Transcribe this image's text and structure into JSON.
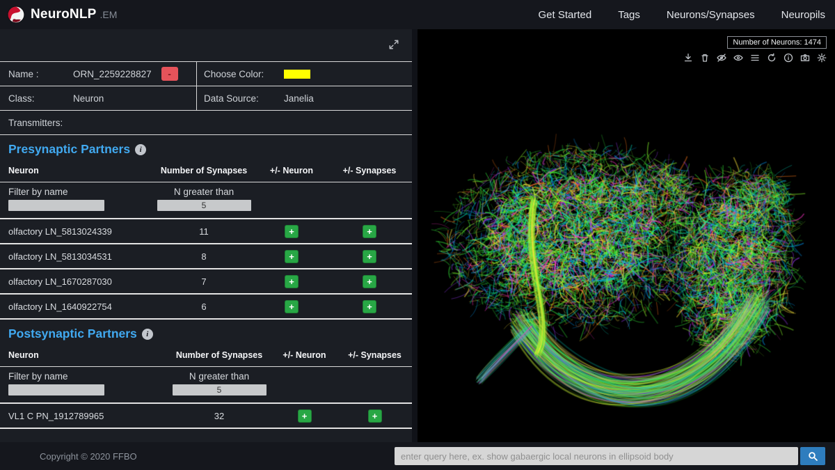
{
  "navbar": {
    "brand": "NeuroNLP",
    "brand_suffix": ".EM",
    "items": [
      {
        "label": "Get Started"
      },
      {
        "label": "Tags"
      },
      {
        "label": "Neurons/Synapses"
      },
      {
        "label": "Neuropils"
      }
    ]
  },
  "info_panel": {
    "name_label": "Name :",
    "name_value": "ORN_2259228827",
    "remove_label": "-",
    "color_label": "Choose Color:",
    "class_label": "Class:",
    "class_value": "Neuron",
    "source_label": "Data Source:",
    "source_value": "Janelia",
    "transmitters_label": "Transmitters:"
  },
  "ui": {
    "info_glyph": "i"
  },
  "presynaptic": {
    "title": "Presynaptic Partners",
    "columns": [
      "Neuron",
      "Number of Synapses",
      "+/- Neuron",
      "+/- Synapses"
    ],
    "filter_label": "Filter by name",
    "threshold_label": "N greater than",
    "threshold_value": "5",
    "add_label": "+",
    "rows": [
      {
        "name": "olfactory LN_5813024339",
        "synapses": "11"
      },
      {
        "name": "olfactory LN_5813034531",
        "synapses": "8"
      },
      {
        "name": "olfactory LN_1670287030",
        "synapses": "7"
      },
      {
        "name": "olfactory LN_1640922754",
        "synapses": "6"
      }
    ]
  },
  "postsynaptic": {
    "title": "Postsynaptic Partners",
    "columns": [
      "Neuron",
      "Number of Synapses",
      "+/- Neuron",
      "+/- Synapses"
    ],
    "filter_label": "Filter by name",
    "threshold_label": "N greater than",
    "threshold_value": "5",
    "add_label": "+",
    "rows": [
      {
        "name": "VL1 C PN_1912789965",
        "synapses": "32"
      }
    ]
  },
  "footer": {
    "copyright": "Copyright © 2020 FFBO"
  },
  "viewer": {
    "neuron_count_label": "Number of Neurons: 1474",
    "icons": [
      "download-icon",
      "trash-icon",
      "eye-slash-icon",
      "eye-icon",
      "list-icon",
      "refresh-icon",
      "info-icon",
      "camera-icon",
      "settings-icon"
    ]
  },
  "query_bar": {
    "placeholder": "enter query here, ex. show gabaergic local neurons in ellipsoid body"
  },
  "colors": {
    "accent_blue": "#41a9f0",
    "add_green": "#28a745",
    "remove_red": "#e5535a",
    "swatch_yellow": "#ffff00",
    "search_blue": "#2e7dbe"
  }
}
